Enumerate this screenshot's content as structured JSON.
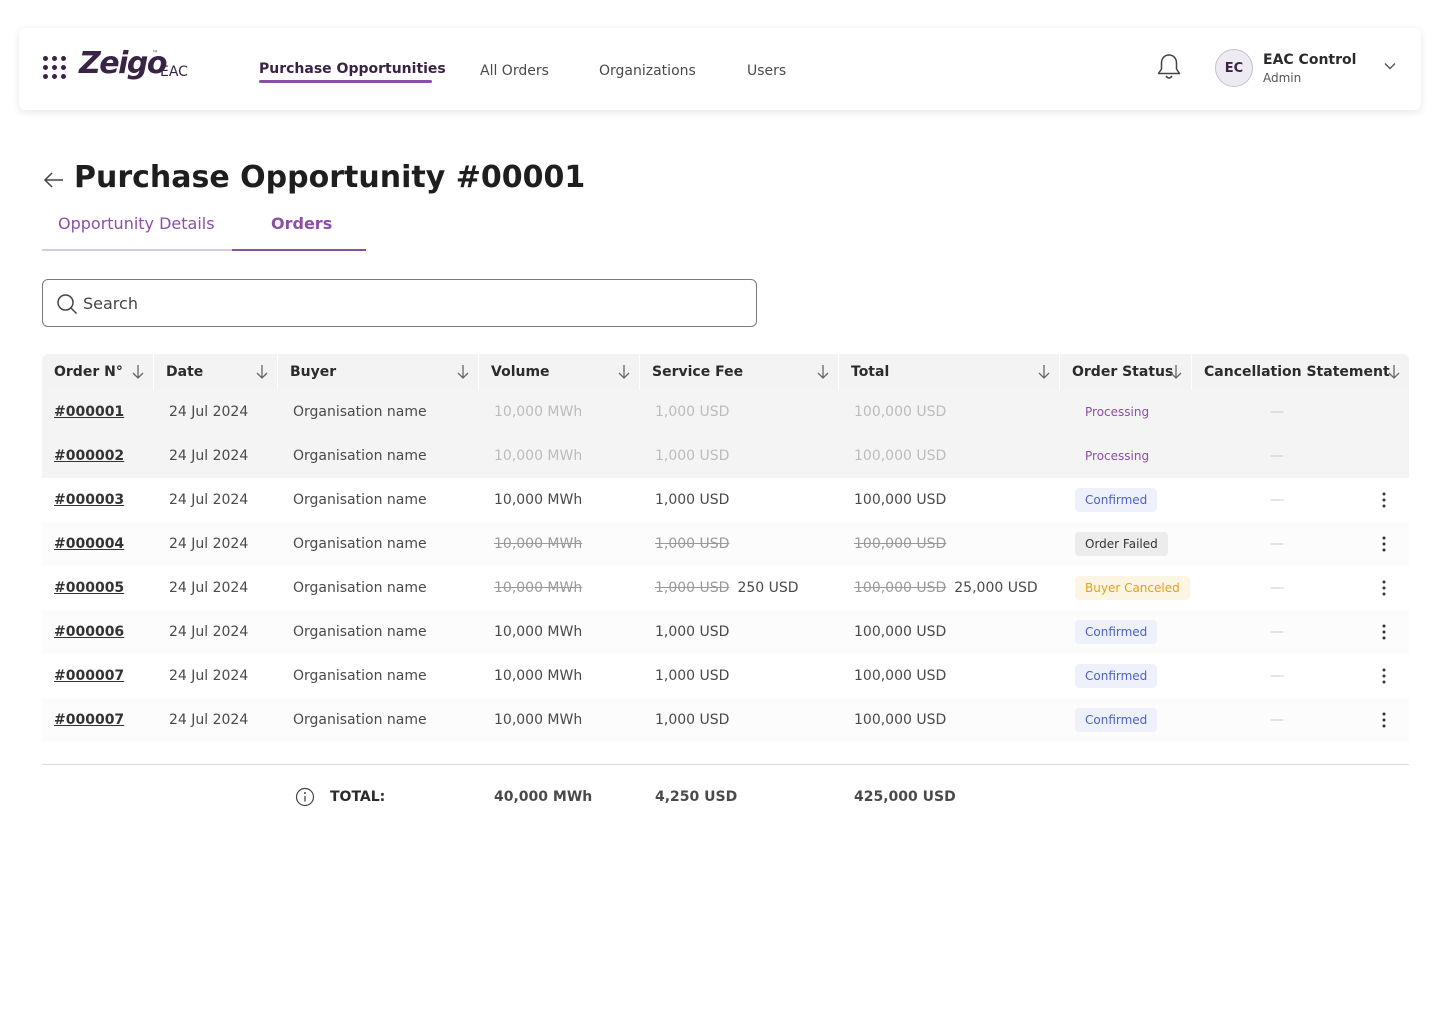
{
  "header": {
    "logo": "Zeigo",
    "logo_tm": "™",
    "logo_sub": "EAC",
    "nav": [
      "Purchase Opportunities",
      "All Orders",
      "Organizations",
      "Users"
    ],
    "user": {
      "initials": "EC",
      "name": "EAC Control",
      "role": "Admin"
    }
  },
  "page": {
    "title": "Purchase Opportunity #00001",
    "tabs": [
      "Opportunity Details",
      "Orders"
    ],
    "active_tab": "Orders"
  },
  "search": {
    "placeholder": "Search",
    "value": ""
  },
  "table": {
    "columns": [
      "Order N°",
      "Date",
      "Buyer",
      "Volume",
      "Service Fee",
      "Total",
      "Order Status",
      "Cancellation Statement"
    ],
    "rows": [
      {
        "order": "#000001",
        "date": "24 Jul 2024",
        "buyer": "Organisation name",
        "volume": "10,000 MWh",
        "fee": "1,000 USD",
        "fee_new": "",
        "total": "100,000 USD",
        "total_new": "",
        "status": "Processing",
        "cancel": "—"
      },
      {
        "order": "#000002",
        "date": "24 Jul 2024",
        "buyer": "Organisation name",
        "volume": "10,000 MWh",
        "fee": "1,000 USD",
        "fee_new": "",
        "total": "100,000 USD",
        "total_new": "",
        "status": "Processing",
        "cancel": "—"
      },
      {
        "order": "#000003",
        "date": "24 Jul 2024",
        "buyer": "Organisation name",
        "volume": "10,000 MWh",
        "fee": "1,000 USD",
        "fee_new": "",
        "total": "100,000 USD",
        "total_new": "",
        "status": "Confirmed",
        "cancel": "—"
      },
      {
        "order": "#000004",
        "date": "24 Jul 2024",
        "buyer": "Organisation name",
        "volume": "10,000 MWh",
        "fee": "1,000 USD",
        "fee_new": "",
        "total": "100,000 USD",
        "total_new": "",
        "status": "Order Failed",
        "cancel": "—"
      },
      {
        "order": "#000005",
        "date": "24 Jul 2024",
        "buyer": "Organisation name",
        "volume": "10,000 MWh",
        "fee": "1,000 USD",
        "fee_new": "250 USD",
        "total": "100,000 USD",
        "total_new": "25,000 USD",
        "status": "Buyer Canceled",
        "cancel": "—"
      },
      {
        "order": "#000006",
        "date": "24 Jul 2024",
        "buyer": "Organisation name",
        "volume": "10,000 MWh",
        "fee": "1,000 USD",
        "fee_new": "",
        "total": "100,000 USD",
        "total_new": "",
        "status": "Confirmed",
        "cancel": "—"
      },
      {
        "order": "#000007",
        "date": "24 Jul 2024",
        "buyer": "Organisation name",
        "volume": "10,000 MWh",
        "fee": "1,000 USD",
        "fee_new": "",
        "total": "100,000 USD",
        "total_new": "",
        "status": "Confirmed",
        "cancel": "—"
      },
      {
        "order": "#000007",
        "date": "24 Jul 2024",
        "buyer": "Organisation name",
        "volume": "10,000 MWh",
        "fee": "1,000 USD",
        "fee_new": "",
        "total": "100,000 USD",
        "total_new": "",
        "status": "Confirmed",
        "cancel": "—"
      }
    ]
  },
  "totals": {
    "label": "TOTAL:",
    "volume": "40,000 MWh",
    "fee": "4,250 USD",
    "total": "425,000 USD"
  },
  "colors": {
    "accent": "#8b4fa5",
    "brand": "#3a2446",
    "confirmed": "#4c62c9",
    "canceled": "#e3a11a"
  }
}
